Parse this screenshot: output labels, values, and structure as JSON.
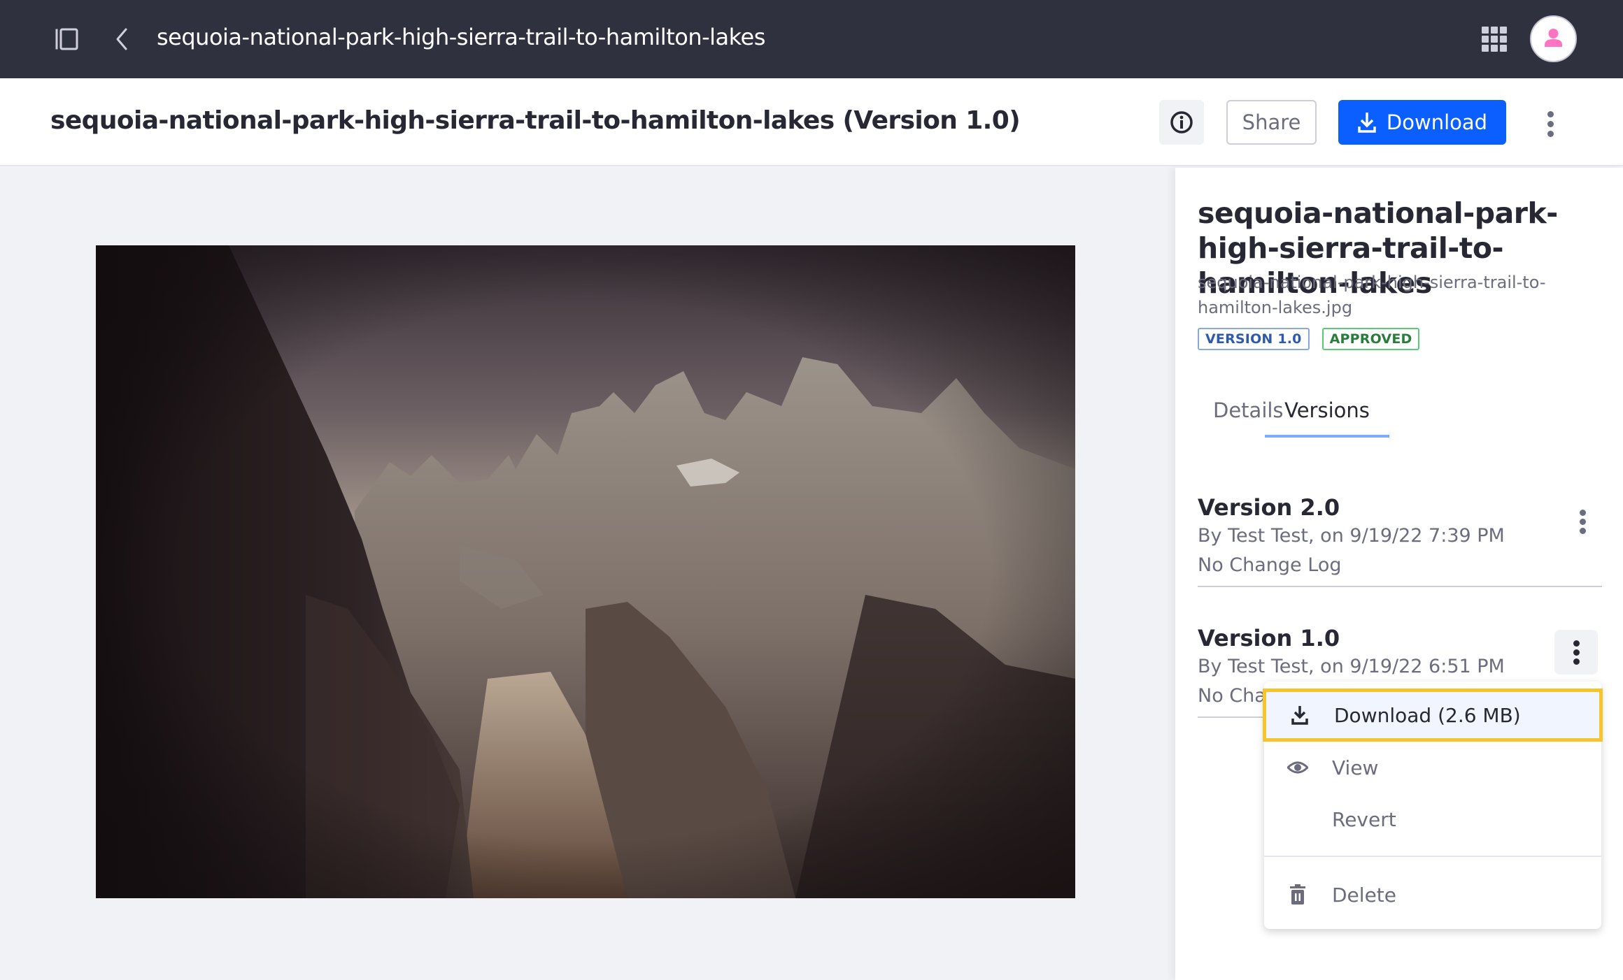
{
  "topbar": {
    "title": "sequoia-national-park-high-sierra-trail-to-hamilton-lakes",
    "icons": [
      "sidebar-toggle-icon",
      "chevron-left-icon",
      "apps-grid-icon",
      "user-avatar-icon"
    ]
  },
  "header": {
    "page_title": "sequoia-national-park-high-sierra-trail-to-hamilton-lakes (Version 1.0)",
    "info_icon": "info-circle-icon",
    "share_label": "Share",
    "download_label": "Download",
    "more_icon": "ellipsis-v-icon"
  },
  "colors": {
    "topbar_bg": "#30313f",
    "primary": "#0b5fff",
    "highlight_border": "#f5c52b",
    "badge_version": "#2e5aac",
    "badge_approved": "#287d3c",
    "avatar_icon": "#ff73c3"
  },
  "sidebar": {
    "title": "sequoia-national-park-high-sierra-trail-to-hamilton-lakes",
    "filename": "sequoia-national-park-high-sierra-trail-to-hamilton-lakes.jpg",
    "badges": {
      "version": "VERSION 1.0",
      "status": "APPROVED"
    },
    "tabs": [
      {
        "label": "Details",
        "active": false
      },
      {
        "label": "Versions",
        "active": true
      }
    ],
    "versions": [
      {
        "title": "Version 2.0",
        "author_line": "By Test Test, on 9/19/22 7:39 PM",
        "changelog": "No Change Log"
      },
      {
        "title": "Version 1.0",
        "author_line": "By Test Test, on 9/19/22 6:51 PM",
        "changelog": "No Change Log"
      }
    ]
  },
  "dropdown": {
    "items": [
      {
        "label": "Download (2.6 MB)",
        "icon": "download-icon",
        "highlighted": true
      },
      {
        "label": "View",
        "icon": "eye-icon"
      },
      {
        "label": "Revert",
        "icon": ""
      },
      {
        "label": "Delete",
        "icon": "trash-icon"
      }
    ]
  },
  "preview": {
    "alt": "Mountain trail photograph"
  }
}
